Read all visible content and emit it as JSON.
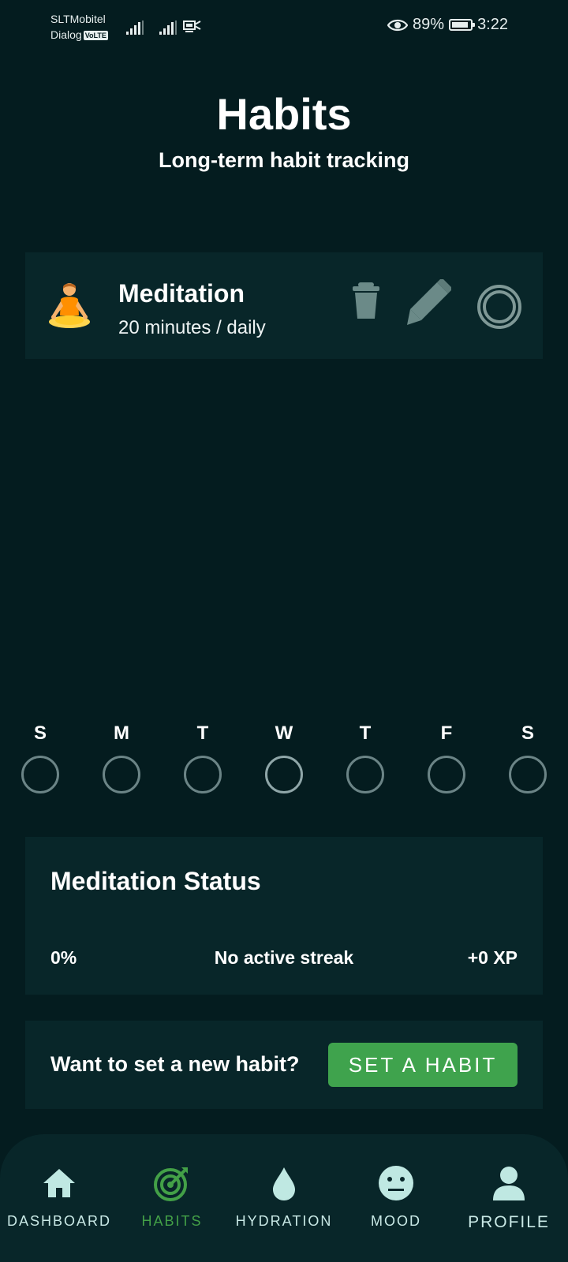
{
  "status_bar": {
    "carrier_1": "SLTMobitel",
    "carrier_2": "Dialog",
    "volte_badge": "VoLTE",
    "battery_percent": "89%",
    "battery_level": 0.89,
    "time": "3:22"
  },
  "header": {
    "title": "Habits",
    "subtitle": "Long-term habit tracking"
  },
  "habit": {
    "emoji": "person-in-lotus-position",
    "name": "Meditation",
    "frequency": "20 minutes / daily"
  },
  "week": {
    "days": [
      {
        "letter": "S",
        "done": false
      },
      {
        "letter": "M",
        "done": false
      },
      {
        "letter": "T",
        "done": false
      },
      {
        "letter": "W",
        "done": false
      },
      {
        "letter": "T",
        "done": false
      },
      {
        "letter": "F",
        "done": false
      },
      {
        "letter": "S",
        "done": false
      }
    ]
  },
  "status_card": {
    "title": "Meditation Status",
    "percent": "0%",
    "streak": "No active streak",
    "xp": "+0 XP"
  },
  "cta": {
    "text": "Want to set a new habit?",
    "button": "SET A HABIT"
  },
  "nav": {
    "items": [
      {
        "label": "DASHBOARD",
        "icon": "home-icon",
        "active": false
      },
      {
        "label": "HABITS",
        "icon": "target-icon",
        "active": true
      },
      {
        "label": "HYDRATION",
        "icon": "water-drop-icon",
        "active": false
      },
      {
        "label": "MOOD",
        "icon": "neutral-face-icon",
        "active": false
      },
      {
        "label": "PROFILE",
        "icon": "person-icon",
        "active": false
      }
    ]
  },
  "colors": {
    "background": "#041c1f",
    "card": "#082629",
    "accent_green": "#3fa34d",
    "nav_icon": "#bfe8e2",
    "muted_icon": "#6b8486"
  }
}
